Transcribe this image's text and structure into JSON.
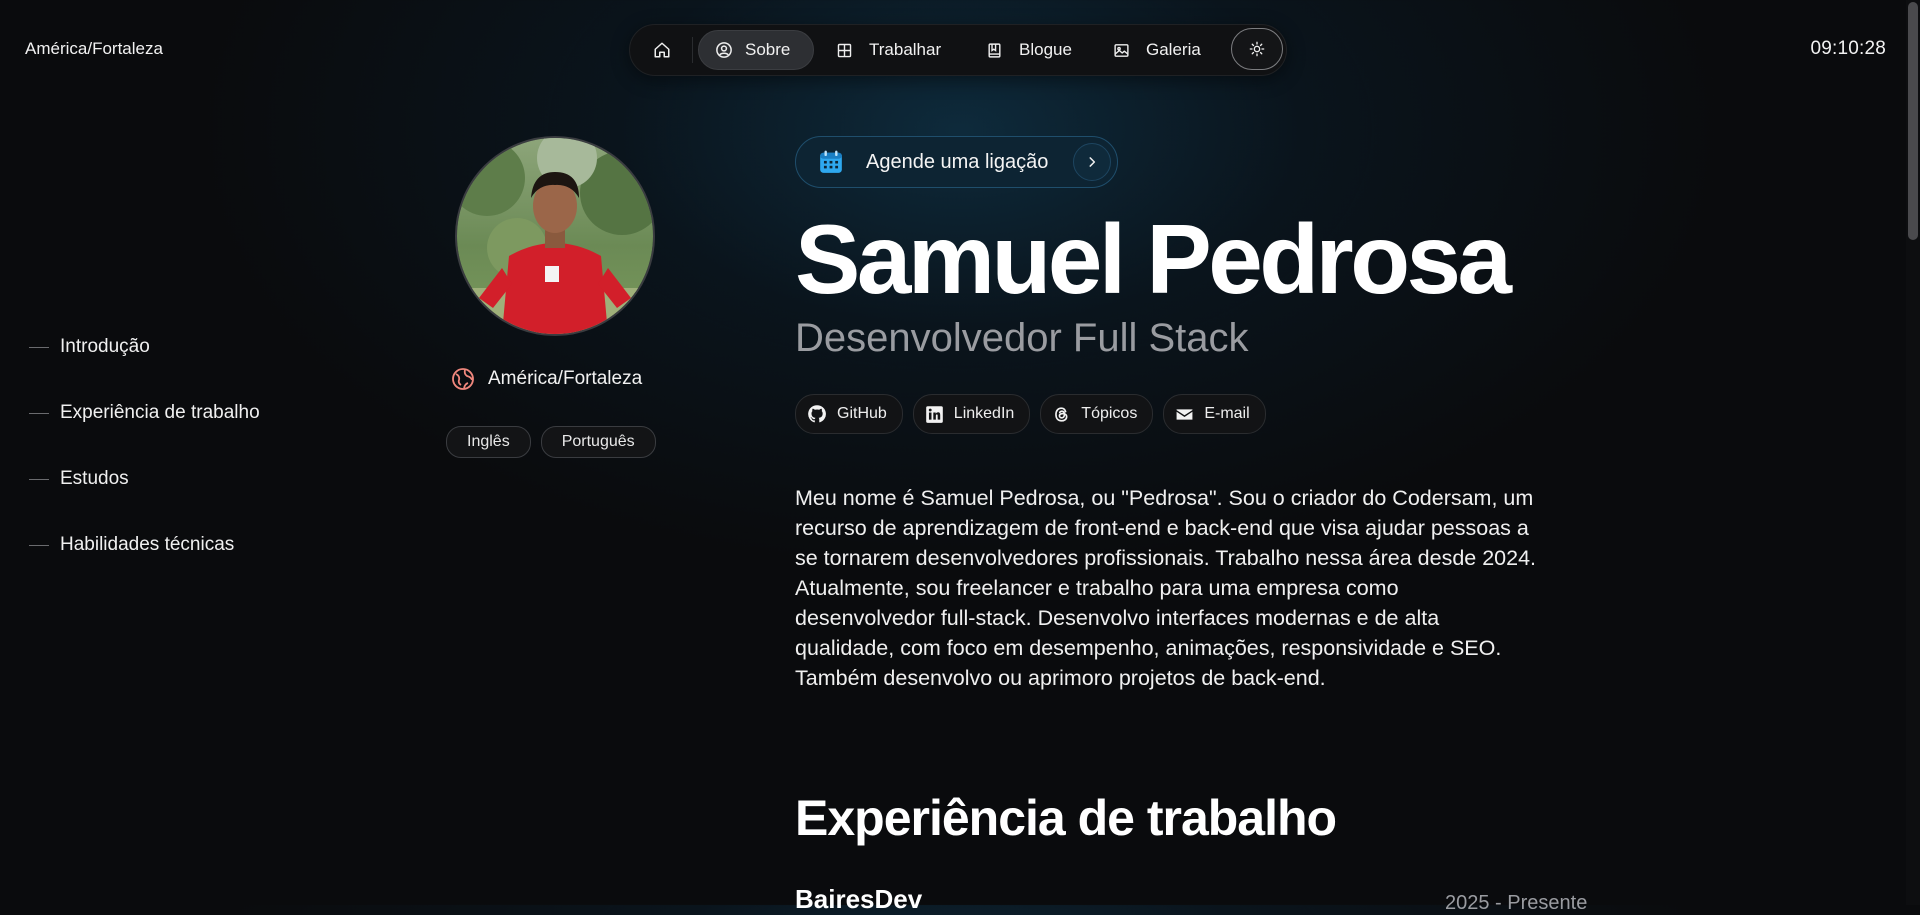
{
  "header": {
    "timezone": "América/Fortaleza",
    "time": "09:10:28"
  },
  "nav": {
    "items": [
      {
        "icon": "home-icon",
        "label": ""
      },
      {
        "icon": "user-circle-icon",
        "label": "Sobre"
      },
      {
        "icon": "grid-icon",
        "label": "Trabalhar"
      },
      {
        "icon": "book-icon",
        "label": "Blogue"
      },
      {
        "icon": "gallery-icon",
        "label": "Galeria"
      },
      {
        "icon": "sun-icon",
        "label": ""
      }
    ]
  },
  "toc": {
    "items": [
      "Introdução",
      "Experiência de trabalho",
      "Estudos",
      "Habilidades técnicas"
    ]
  },
  "profile": {
    "location": "América/Fortaleza",
    "languages": [
      "Inglês",
      "Português"
    ]
  },
  "cta": {
    "label": "Agende uma ligação"
  },
  "hero": {
    "name": "Samuel Pedrosa",
    "role": "Desenvolvedor Full Stack"
  },
  "socials": [
    {
      "icon": "github-icon",
      "label": "GitHub"
    },
    {
      "icon": "linkedin-icon",
      "label": "LinkedIn"
    },
    {
      "icon": "threads-icon",
      "label": "Tópicos"
    },
    {
      "icon": "mail-icon",
      "label": "E-mail"
    }
  ],
  "bio": {
    "lines": [
      "Meu nome é Samuel Pedrosa, ou \"Pedrosa\". Sou o criador do Codersam, um",
      "recurso de aprendizagem de front-end e back-end que visa ajudar pessoas a",
      "se tornarem desenvolvedores profissionais. Trabalho nessa área desde 2024.",
      "Atualmente, sou freelancer e trabalho para uma empresa como",
      "desenvolvedor full-stack. Desenvolvo interfaces modernas e de alta",
      "qualidade, com foco em desempenho, animações, responsividade e SEO.",
      "Também desenvolvo ou aprimoro projetos de back-end."
    ]
  },
  "experience": {
    "title": "Experiência de trabalho",
    "company": "BairesDev",
    "period": "2025 - Presente"
  },
  "colors": {
    "background": "#0a0b0d",
    "accent_glow": "#0e2c3e",
    "cta_background": "#0d2433",
    "cta_icon": "#2ea8ef",
    "muted_text": "#9a9ca1",
    "location_icon": "#f0877d"
  }
}
